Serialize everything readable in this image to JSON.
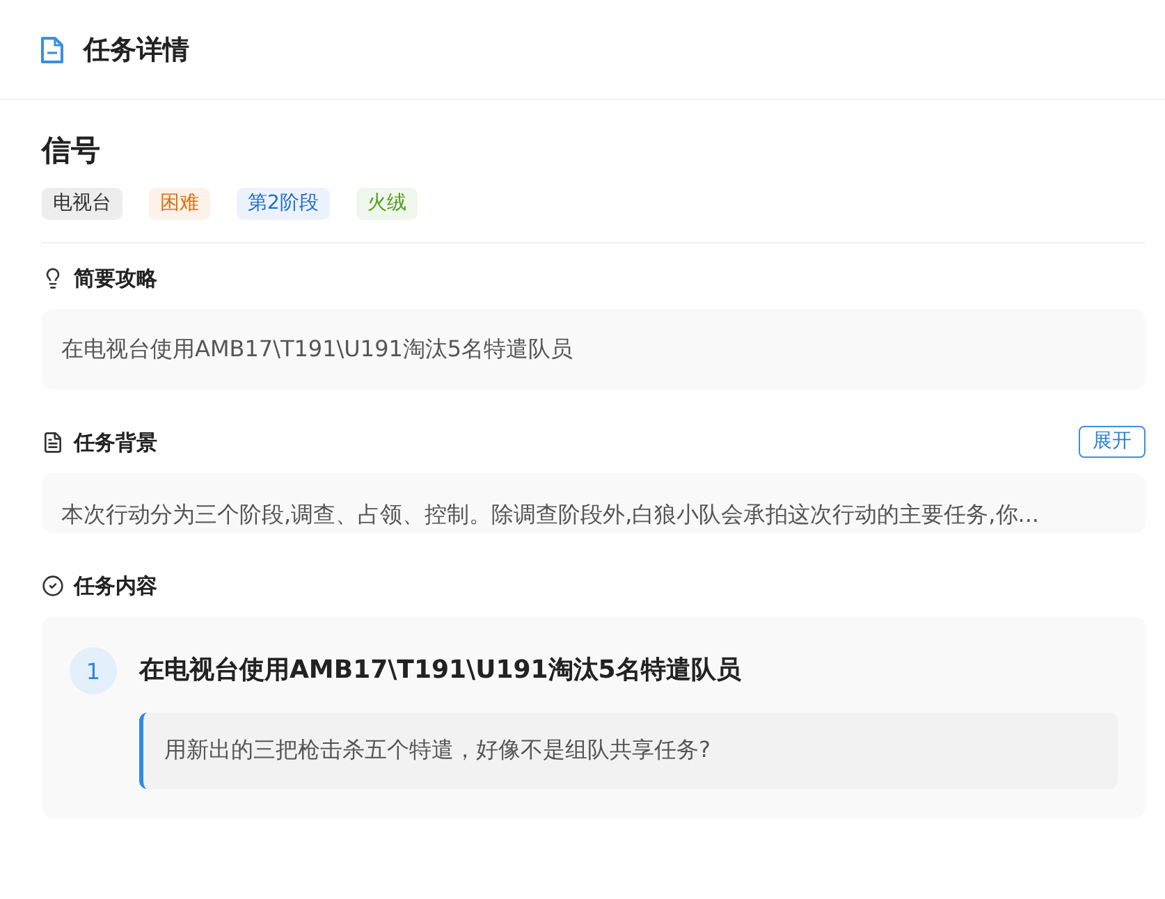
{
  "header": {
    "title": "任务详情"
  },
  "task": {
    "name": "信号",
    "tags": [
      {
        "label": "电视台",
        "color": "#333333"
      },
      {
        "label": "困难",
        "color": "#d9700f"
      },
      {
        "label": "第2阶段",
        "color": "#1f6fce"
      },
      {
        "label": "火绒",
        "color": "#4f9f1c"
      }
    ]
  },
  "sections": [
    {
      "kind": "tip",
      "title": "简要攻略",
      "text": "在电视台使用AMB17\\T191\\U191淘汰5名特遣队员"
    },
    {
      "kind": "background",
      "title": "任务背景",
      "button": "展开",
      "text": "本次行动分为三个阶段,调查、占领、控制。除调查阶段外,白狼小队会承拍这次行动的主要任务,你..."
    },
    {
      "kind": "steps",
      "title": "任务内容",
      "steps": [
        {
          "number": "1",
          "title": "在电视台使用AMB17\\T191\\U191淘汰5名特遣队员",
          "note": "用新出的三把枪击杀五个特遣，好像不是组队共享任务?"
        }
      ]
    }
  ]
}
